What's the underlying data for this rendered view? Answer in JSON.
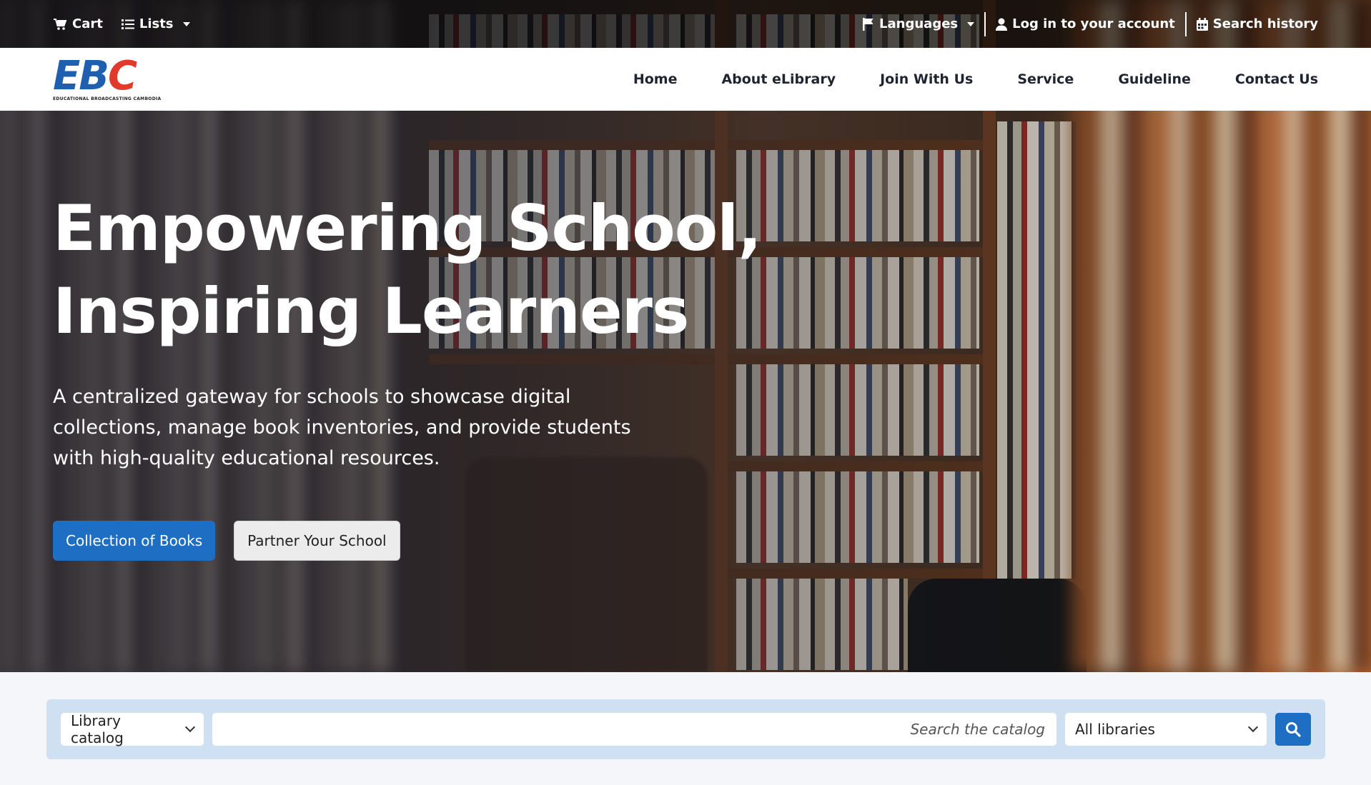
{
  "utility": {
    "cart_label": "Cart",
    "lists_label": "Lists",
    "languages_label": "Languages",
    "login_label": "Log in to your account",
    "search_history_label": "Search history"
  },
  "logo": {
    "mark_e": "E",
    "mark_b": "B",
    "mark_c": "C",
    "subtitle": "EDUCATIONAL BROADCASTING CAMBODIA"
  },
  "nav": {
    "items": [
      "Home",
      "About eLibrary",
      "Join With Us",
      "Service",
      "Guideline",
      "Contact Us"
    ]
  },
  "hero": {
    "title_line1": "Empowering School,",
    "title_line2": "Inspiring Learners",
    "description": "A centralized gateway for schools to showcase digital collections, manage book inventories, and provide students with high-quality educational resources.",
    "primary_button": "Collection of Books",
    "secondary_button": "Partner Your School"
  },
  "search": {
    "type_selected": "Library catalog",
    "placeholder": "Search the catalog",
    "library_selected": "All libraries"
  },
  "colors": {
    "brand_blue": "#1e6ec4",
    "logo_blue": "#1e5fb0",
    "logo_red": "#e23a2a",
    "search_bar_bg": "#cfe0f3"
  },
  "icons": [
    "cart-icon",
    "list-icon",
    "flag-icon",
    "user-icon",
    "calendar-icon",
    "search-icon"
  ]
}
